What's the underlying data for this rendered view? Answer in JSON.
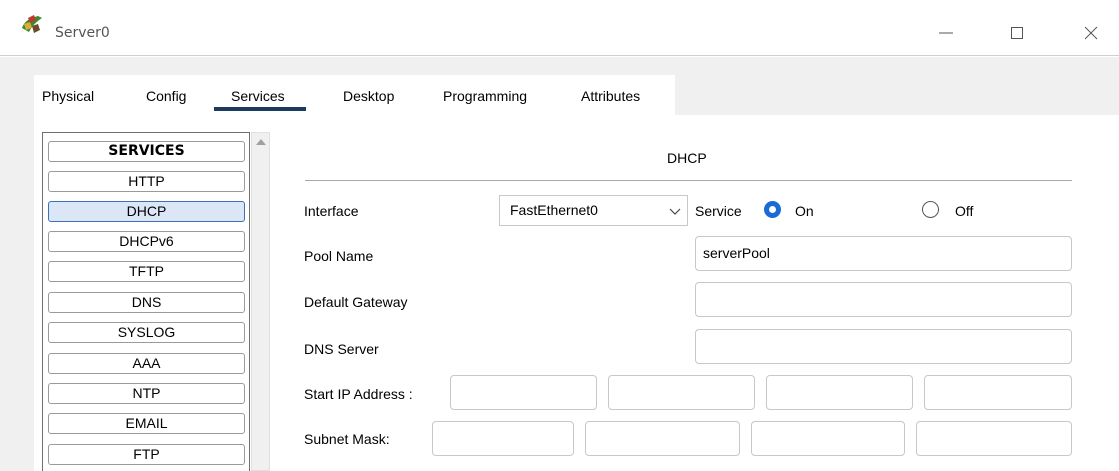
{
  "window": {
    "title": "Server0",
    "icon": "server-app-icon"
  },
  "tabs": [
    {
      "label": "Physical"
    },
    {
      "label": "Config"
    },
    {
      "label": "Services",
      "active": true
    },
    {
      "label": "Desktop"
    },
    {
      "label": "Programming"
    },
    {
      "label": "Attributes"
    }
  ],
  "services": {
    "header": "SERVICES",
    "items": [
      "HTTP",
      "DHCP",
      "DHCPv6",
      "TFTP",
      "DNS",
      "SYSLOG",
      "AAA",
      "NTP",
      "EMAIL",
      "FTP"
    ],
    "selected": "DHCP"
  },
  "dhcp": {
    "title": "DHCP",
    "interface_label": "Interface",
    "interface_value": "FastEthernet0",
    "service_label": "Service",
    "on_label": "On",
    "off_label": "Off",
    "service_state": "On",
    "pool_name_label": "Pool Name",
    "pool_name_value": "serverPool",
    "default_gateway_label": "Default Gateway",
    "default_gateway_value": "",
    "dns_server_label": "DNS Server",
    "dns_server_value": "",
    "start_ip_label": "Start IP Address :",
    "start_ip_octets": [
      "",
      "",
      "",
      ""
    ],
    "subnet_mask_label": "Subnet Mask:",
    "subnet_mask_octets": [
      "",
      "",
      "",
      ""
    ]
  },
  "colors": {
    "accent": "#1a6ad8",
    "tab_underline": "#1e3a5f",
    "selected_item_bg": "#dbe7f6",
    "panel_bg": "#f0f0f0"
  }
}
